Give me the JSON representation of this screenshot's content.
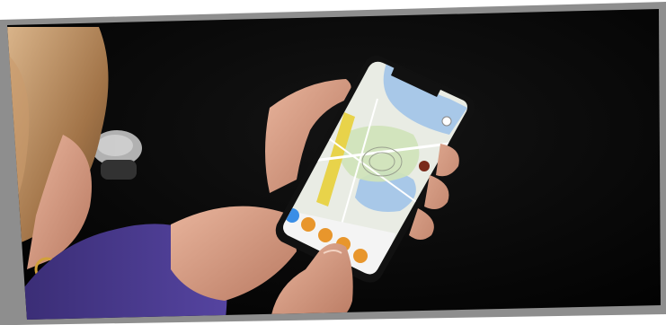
{
  "photo": {
    "subject": "hand-holding-smartphone-with-map-app",
    "colors": {
      "frame": "#8e8e8e",
      "background": "#050505",
      "hair": "#b58a5c",
      "sweater": "#4a3a8c",
      "skin": "#d9a088",
      "phone": "#111111",
      "map_land": "#e9ece4",
      "map_water": "#a8c8e8",
      "map_park": "#cfe3b8",
      "map_road_yellow": "#e8d34a",
      "app_icon_orange": "#e8962c",
      "app_icon_blue": "#3a8ee6"
    }
  }
}
